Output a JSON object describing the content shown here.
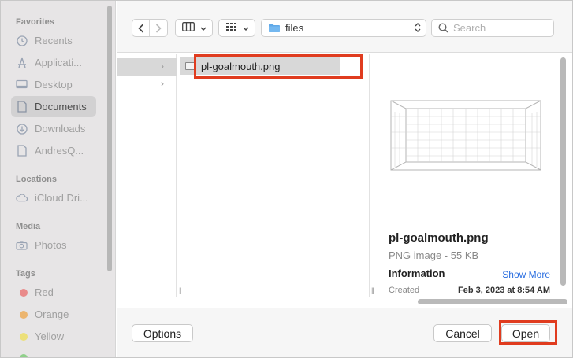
{
  "sidebar": {
    "favorites_heading": "Favorites",
    "favorites": [
      {
        "label": "Recents",
        "icon": "clock-icon"
      },
      {
        "label": "Applicati...",
        "icon": "applications-icon"
      },
      {
        "label": "Desktop",
        "icon": "desktop-icon"
      },
      {
        "label": "Documents",
        "icon": "document-icon",
        "selected": true
      },
      {
        "label": "Downloads",
        "icon": "download-icon"
      },
      {
        "label": "AndresQ...",
        "icon": "file-icon"
      }
    ],
    "locations_heading": "Locations",
    "locations": [
      {
        "label": "iCloud Dri...",
        "icon": "cloud-icon"
      }
    ],
    "media_heading": "Media",
    "media": [
      {
        "label": "Photos",
        "icon": "camera-icon"
      }
    ],
    "tags_heading": "Tags",
    "tags": [
      {
        "label": "Red",
        "color": "#e98a8a"
      },
      {
        "label": "Orange",
        "color": "#ecb56f"
      },
      {
        "label": "Yellow",
        "color": "#ece07a"
      }
    ]
  },
  "toolbar": {
    "back_icon": "chevron-left-icon",
    "forward_icon": "chevron-right-icon",
    "view_columns_icon": "columns-icon",
    "view_grid_icon": "grid-icon",
    "current_folder": "files",
    "search_placeholder": "Search"
  },
  "browser": {
    "selected_file": "pl-goalmouth.png"
  },
  "preview": {
    "filename": "pl-goalmouth.png",
    "kind_size": "PNG image - 55 KB",
    "info_heading": "Information",
    "show_more": "Show More",
    "created_label": "Created",
    "created_value": "Feb 3, 2023 at 8:54 AM"
  },
  "footer": {
    "options_label": "Options",
    "cancel_label": "Cancel",
    "open_label": "Open"
  },
  "colors": {
    "highlight": "#e03c1f",
    "link": "#2a6ee0"
  }
}
